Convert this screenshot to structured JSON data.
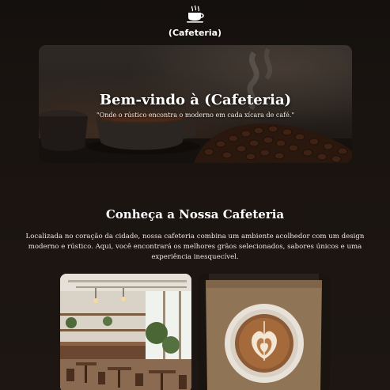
{
  "header": {
    "logo_icon": "coffee-cup-icon",
    "brand": "(Cafeteria)"
  },
  "hero": {
    "title": "Bem-vindo à (Cafeteria)",
    "subtitle": "\"Onde o rústico encontra o moderno em cada xícara de café.\""
  },
  "about": {
    "title": "Conheça a Nossa Cafeteria",
    "text": "Localizada no coração da cidade, nossa cafeteria combina um ambiente acolhedor com um design moderno e rústico. Aqui, você encontrará os melhores grãos selecionados, sabores únicos e uma experiência inesquecível."
  },
  "gallery": {
    "items": [
      "cafe-interior-photo",
      "latte-art-photo"
    ]
  }
}
